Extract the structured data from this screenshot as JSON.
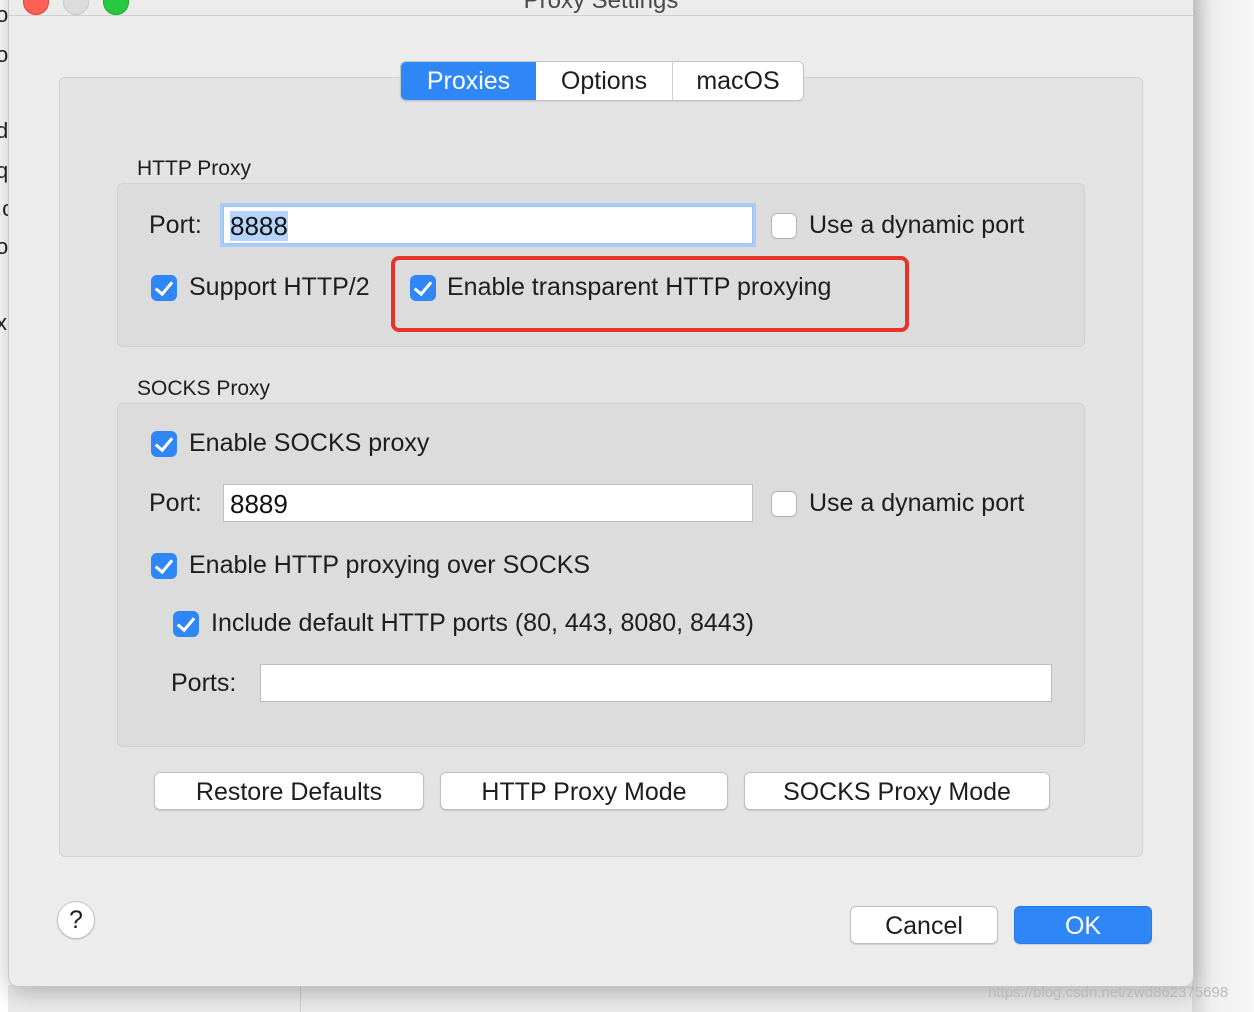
{
  "window": {
    "title": "Proxy Settings"
  },
  "background_fragments": [
    "or",
    "o",
    "d",
    "q",
    ".c",
    "o",
    "x"
  ],
  "tabs": [
    {
      "label": "Proxies",
      "active": true
    },
    {
      "label": "Options",
      "active": false
    },
    {
      "label": "macOS",
      "active": false
    }
  ],
  "http_proxy": {
    "group_title": "HTTP Proxy",
    "port_label": "Port:",
    "port_value": "8888",
    "dynamic_port_label": "Use a dynamic port",
    "dynamic_port_checked": false,
    "http2_label": "Support HTTP/2",
    "http2_checked": true,
    "transparent_label": "Enable transparent HTTP proxying",
    "transparent_checked": true
  },
  "socks_proxy": {
    "group_title": "SOCKS Proxy",
    "enable_label": "Enable SOCKS proxy",
    "enable_checked": true,
    "port_label": "Port:",
    "port_value": "8889",
    "dynamic_port_label": "Use a dynamic port",
    "dynamic_port_checked": false,
    "http_over_socks_label": "Enable HTTP proxying over SOCKS",
    "http_over_socks_checked": true,
    "include_default_ports_label": "Include default HTTP ports (80, 443, 8080, 8443)",
    "include_default_ports_checked": true,
    "ports_label": "Ports:",
    "ports_value": ""
  },
  "actions": {
    "restore_defaults": "Restore Defaults",
    "http_proxy_mode": "HTTP Proxy Mode",
    "socks_proxy_mode": "SOCKS Proxy Mode",
    "cancel": "Cancel",
    "ok": "OK",
    "help": "?"
  },
  "watermark": "https://blog.csdn.net/zwd862375698",
  "colors": {
    "accent": "#2f86f6",
    "highlight": "#e8332a",
    "dialog_bg": "#ececec"
  }
}
